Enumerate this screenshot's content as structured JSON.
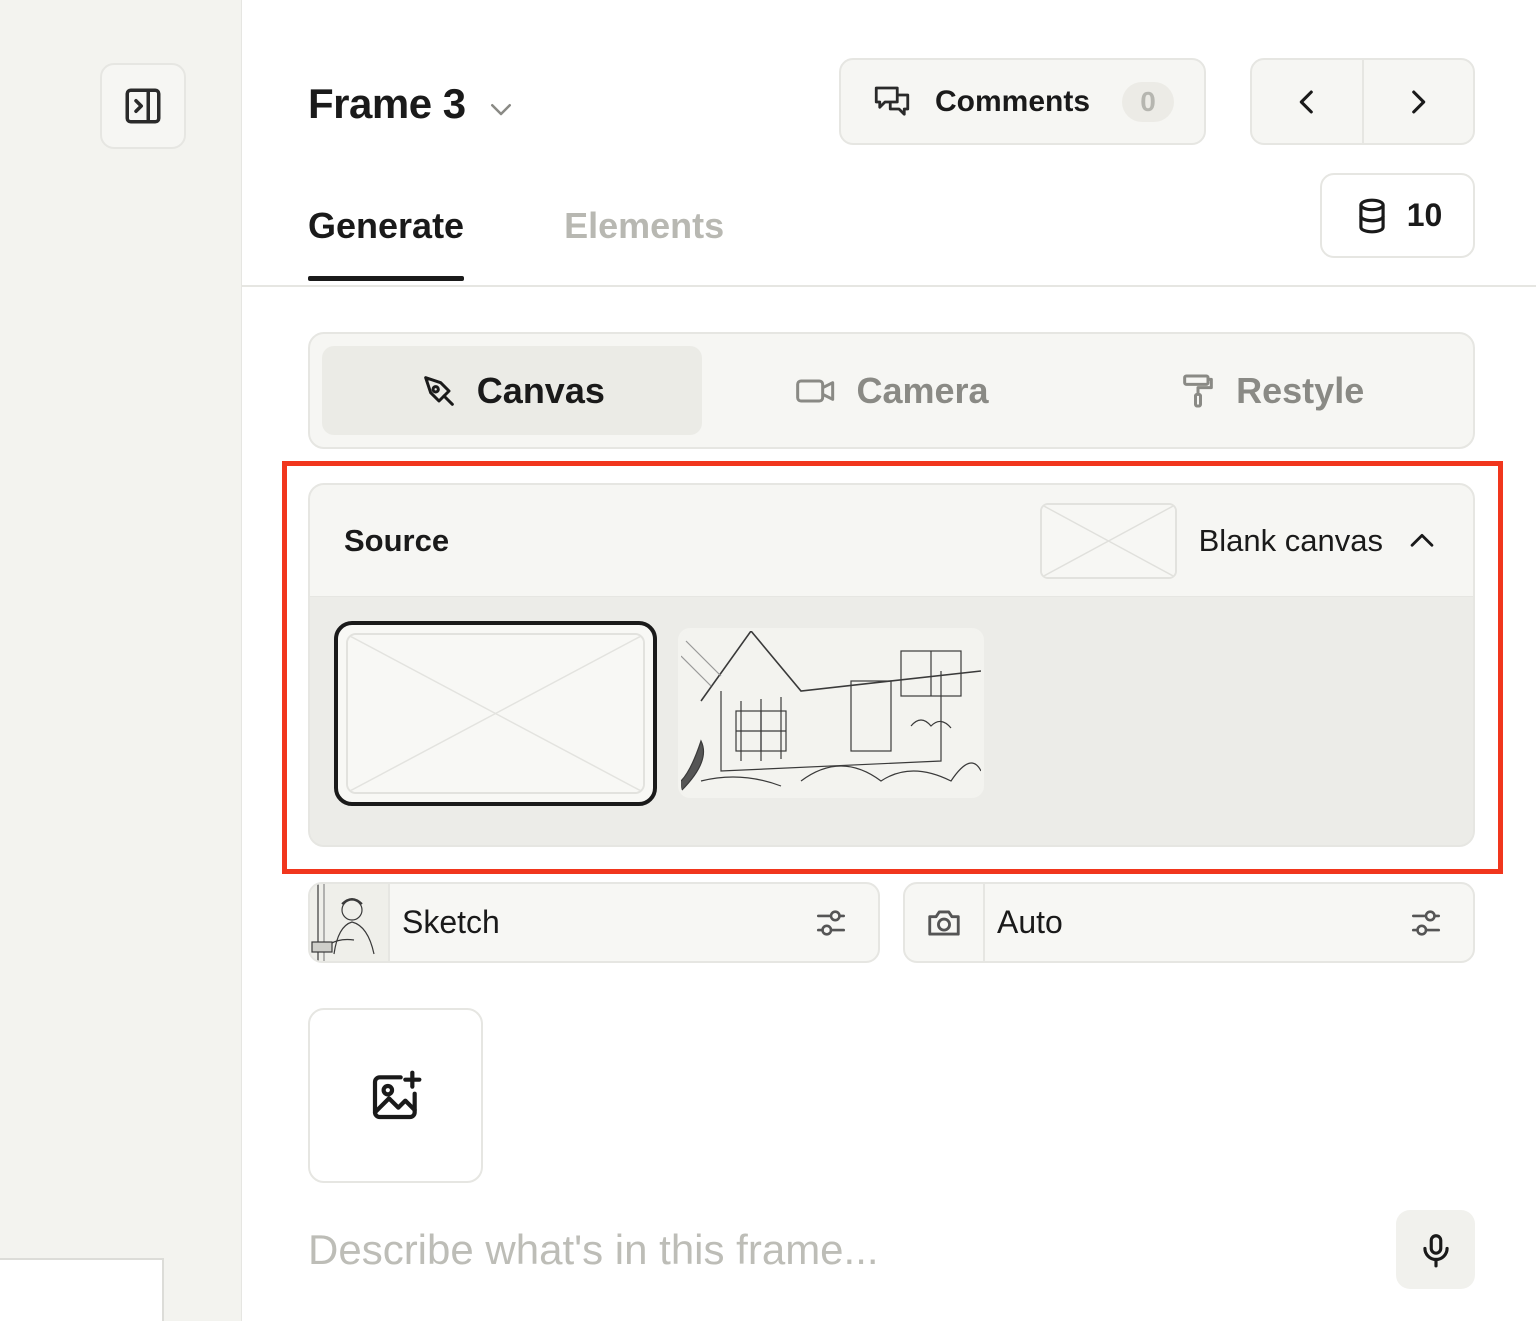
{
  "header": {
    "frame_name": "Frame 3",
    "comments_label": "Comments",
    "comments_count": "0",
    "credits": "10"
  },
  "tabs": [
    {
      "label": "Generate",
      "active": true
    },
    {
      "label": "Elements",
      "active": false
    }
  ],
  "modes": [
    {
      "label": "Canvas",
      "icon": "pen-nib-icon",
      "active": true
    },
    {
      "label": "Camera",
      "icon": "video-camera-icon",
      "active": false
    },
    {
      "label": "Restyle",
      "icon": "paint-roller-icon",
      "active": false
    }
  ],
  "source": {
    "title": "Source",
    "selected": "Blank canvas",
    "options": [
      {
        "name": "blank-canvas",
        "selected": true
      },
      {
        "name": "house-sketch",
        "selected": false
      }
    ]
  },
  "style": {
    "label": "Sketch"
  },
  "camera": {
    "label": "Auto"
  },
  "prompt": {
    "placeholder": "Describe what's in this frame..."
  },
  "colors": {
    "highlight": "#f1361d",
    "panel_bg": "#f6f6f3",
    "text": "#1a1a1a",
    "muted": "#b8b8b2"
  }
}
